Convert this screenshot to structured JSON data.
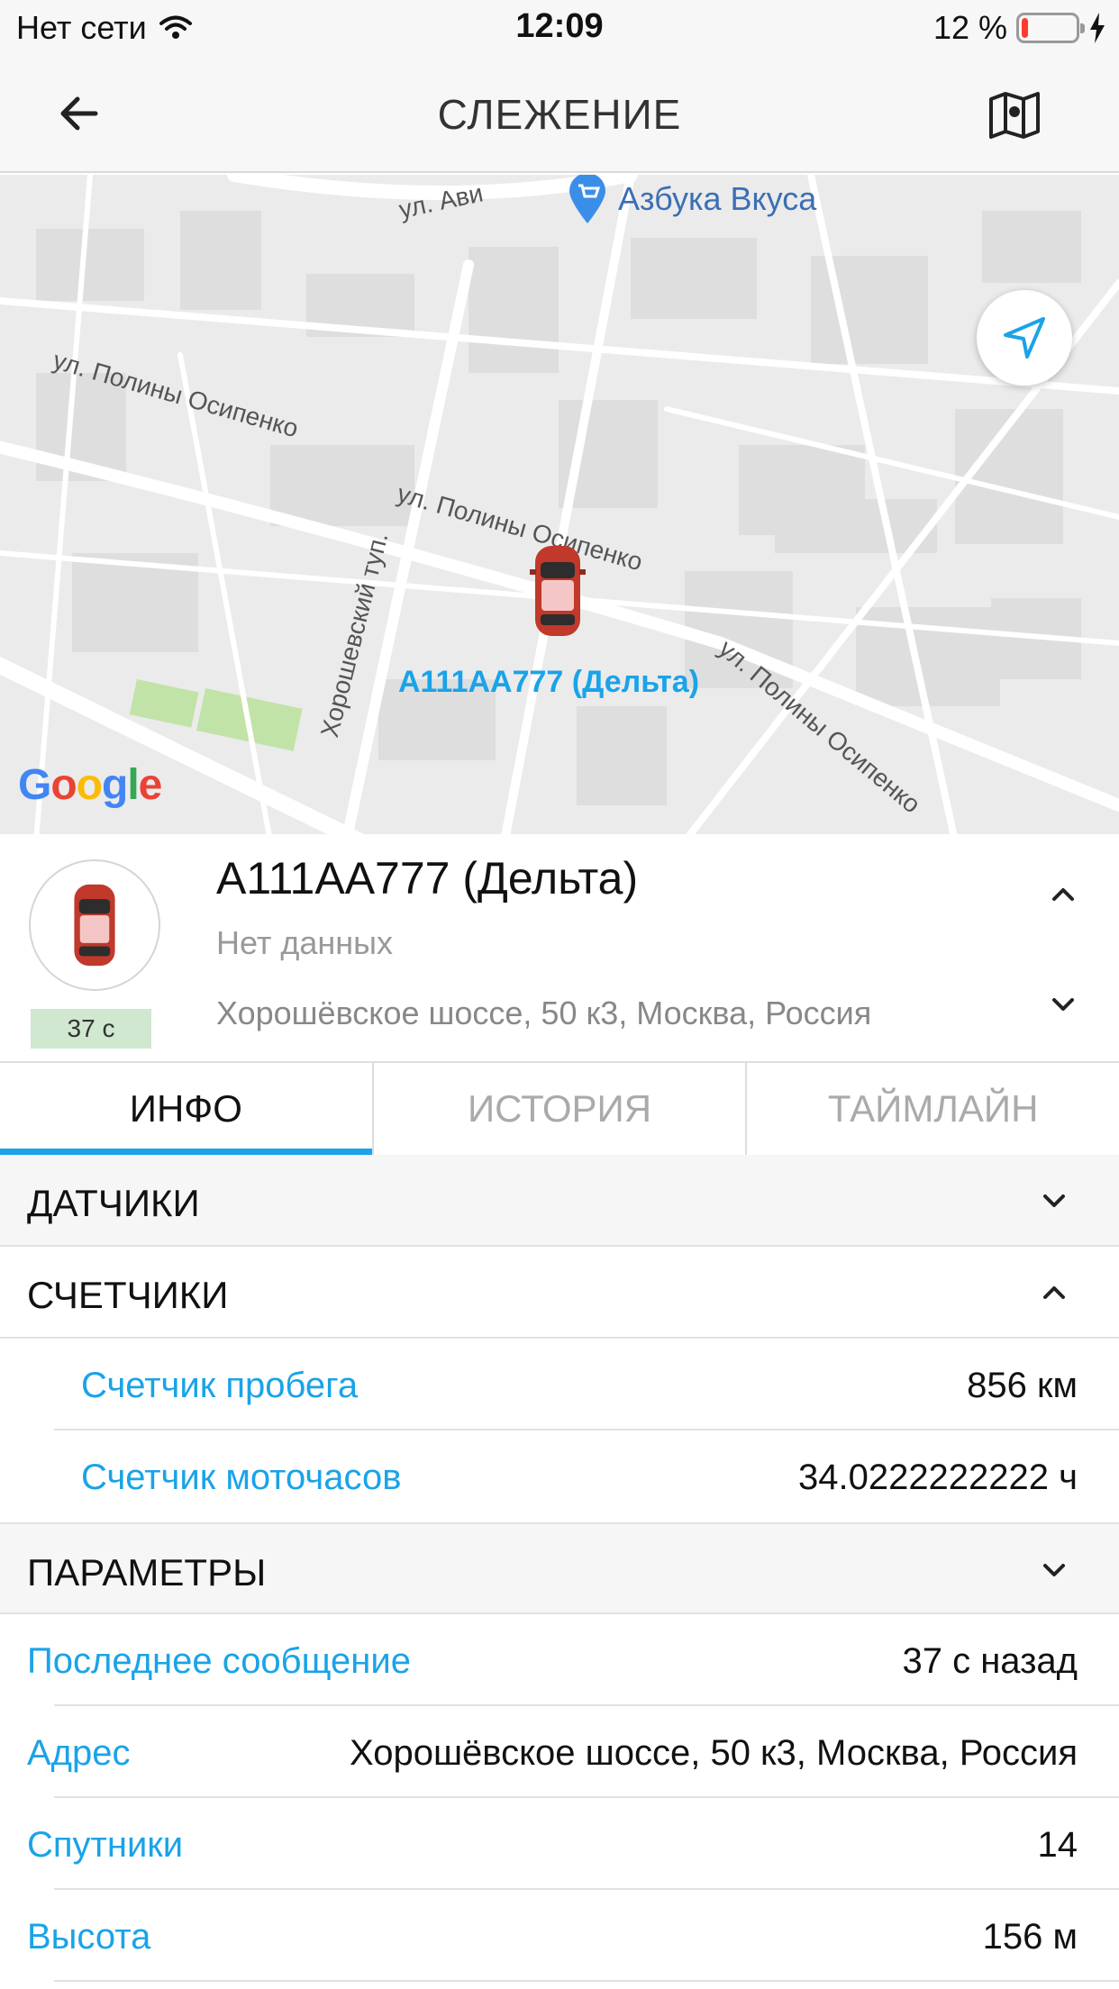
{
  "status_bar": {
    "carrier": "Нет сети",
    "time": "12:09",
    "battery_text": "12 %",
    "battery_level": 0.12,
    "battery_color": "#ff3b30"
  },
  "navbar": {
    "title": "СЛЕЖЕНИЕ",
    "back_icon": "arrow-left-icon",
    "map_icon": "map-icon"
  },
  "map": {
    "poi_label": "Азбука Вкуса",
    "streets": [
      "ул. Ави",
      "ул. Полины Осипенко",
      "ул. Полины Осипенко",
      "Хорошевский туп.",
      "ул. Полины Осипенко"
    ],
    "marker_label": "А111АА777 (Дельта)",
    "provider": "Google"
  },
  "unit": {
    "name": "А111АА777 (Дельта)",
    "status": "Нет данных",
    "address": "Хорошёвское шоссе, 50 к3, Москва, Россия",
    "age": "37 с"
  },
  "tabs": [
    {
      "label": "ИНФО",
      "active": true
    },
    {
      "label": "ИСТОРИЯ",
      "active": false
    },
    {
      "label": "ТАЙМЛАЙН",
      "active": false
    }
  ],
  "sections": {
    "sensors": {
      "title": "ДАТЧИКИ",
      "expanded": false
    },
    "counters": {
      "title": "СЧЕТЧИКИ",
      "expanded": true,
      "rows": [
        {
          "label": "Счетчик пробега",
          "value": "856 км"
        },
        {
          "label": "Счетчик моточасов",
          "value": "34.0222222222 ч"
        }
      ]
    },
    "params": {
      "title": "ПАРАМЕТРЫ",
      "expanded": false,
      "rows": [
        {
          "label": "Последнее сообщение",
          "value": "37 с назад"
        },
        {
          "label": "Адрес",
          "value": "Хорошёвское шоссе, 50 к3, Москва, Россия"
        },
        {
          "label": "Спутники",
          "value": "14"
        },
        {
          "label": "Высота",
          "value": "156 м"
        }
      ]
    }
  },
  "colors": {
    "accent": "#1aa3e8",
    "age_badge": "#cfe8cf",
    "car": "#c0392b"
  }
}
